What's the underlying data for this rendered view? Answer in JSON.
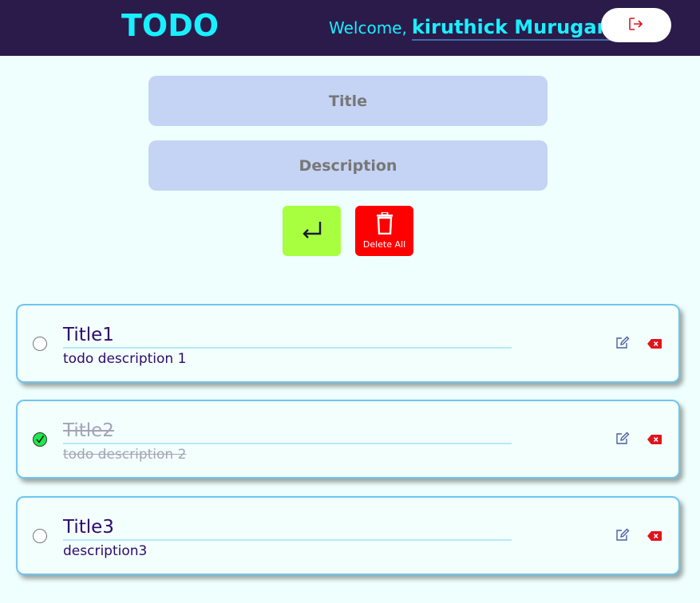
{
  "header": {
    "brand": "TODO",
    "welcome_label": "Welcome,",
    "user_name": "kiruthick Murugan",
    "logout_icon": "logout-icon"
  },
  "form": {
    "title_placeholder": "Title",
    "description_placeholder": "Description",
    "add_icon": "enter-icon",
    "delete_all_label": "Delete All",
    "delete_all_icon": "trash-icon"
  },
  "todos": [
    {
      "title": "Title1",
      "description": "todo description 1",
      "completed": false
    },
    {
      "title": "Title2",
      "description": "todo description 2",
      "completed": true
    },
    {
      "title": "Title3",
      "description": "description3",
      "completed": false
    }
  ],
  "colors": {
    "header_bg": "#2a1b4b",
    "accent": "#18f0ff",
    "page_bg": "#effffd",
    "input_bg": "#c5d4f4",
    "add_button": "#a7ff3f",
    "delete_all_button": "#ff0000",
    "card_border": "#6ec6ef",
    "todo_text": "#2d0a6b",
    "completed_text": "#a4a4b6",
    "check_green": "#1de94a"
  }
}
